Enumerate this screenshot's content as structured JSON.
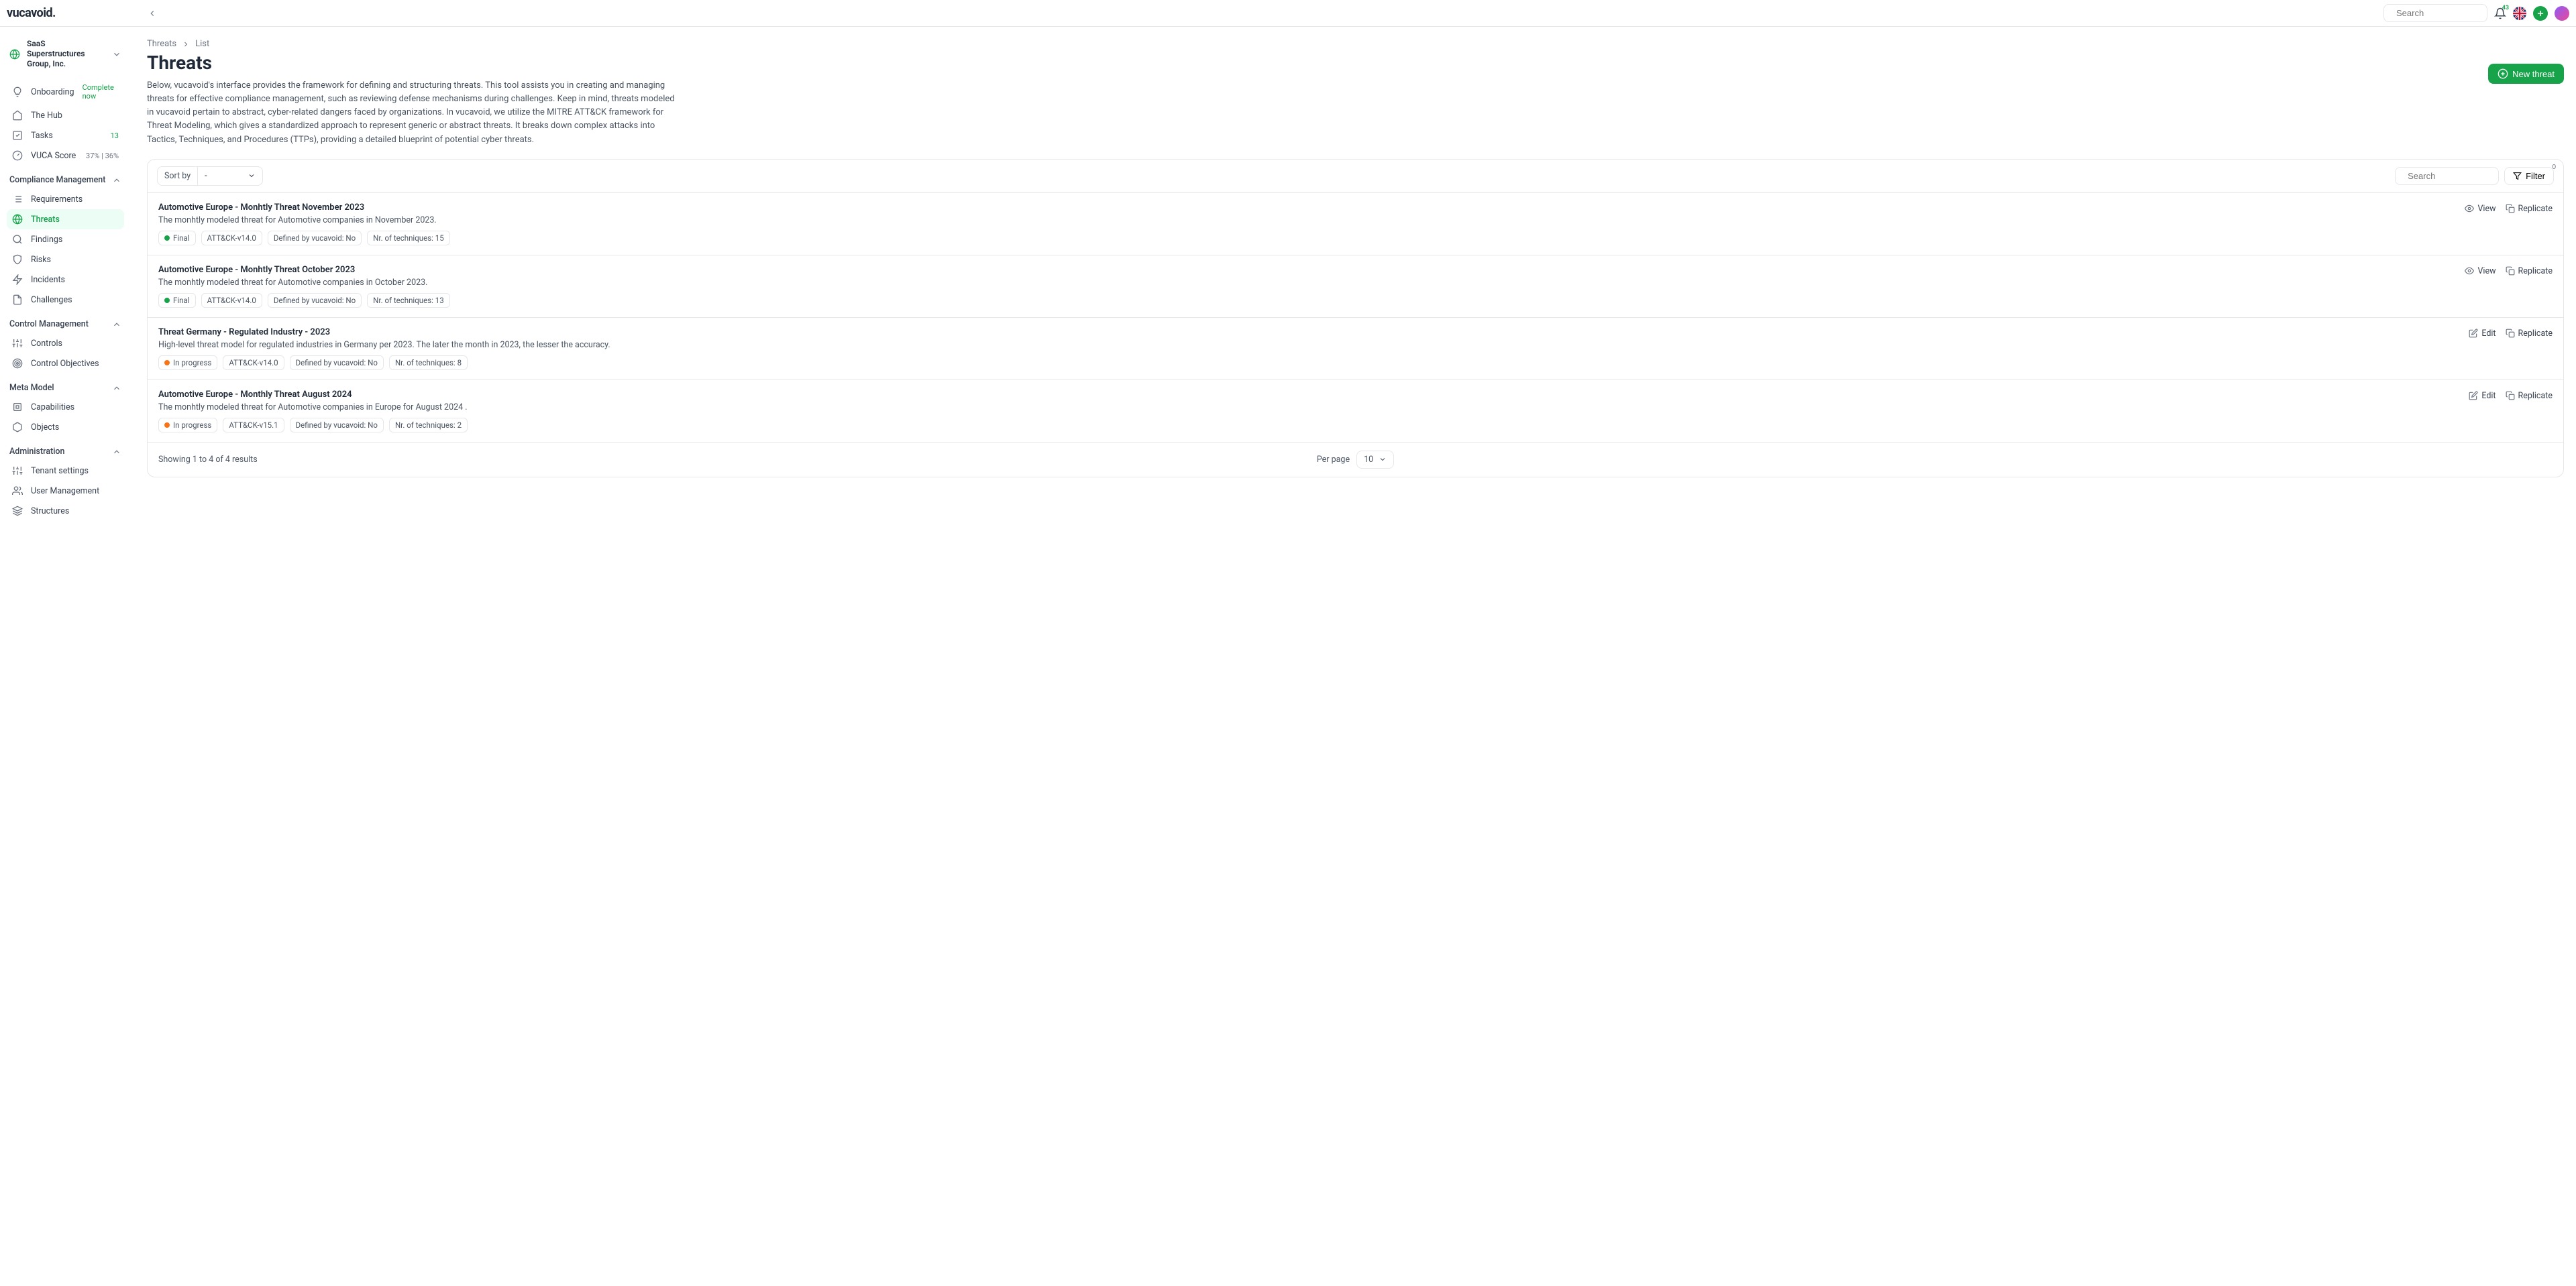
{
  "header": {
    "logo": "vucavoid.",
    "search_placeholder": "Search",
    "notif_count": "43"
  },
  "org": {
    "name": "SaaS Superstructures Group, Inc."
  },
  "sidebar": {
    "top": [
      {
        "label": "Onboarding",
        "badge": "Complete now",
        "badge_kind": "green"
      },
      {
        "label": "The Hub"
      },
      {
        "label": "Tasks",
        "badge": "13",
        "badge_kind": "green"
      },
      {
        "label": "VUCA Score",
        "badge": "37% | 36%",
        "badge_kind": "grey"
      }
    ],
    "sections": [
      {
        "title": "Compliance Management",
        "items": [
          {
            "label": "Requirements"
          },
          {
            "label": "Threats",
            "active": true
          },
          {
            "label": "Findings"
          },
          {
            "label": "Risks"
          },
          {
            "label": "Incidents"
          },
          {
            "label": "Challenges"
          }
        ]
      },
      {
        "title": "Control Management",
        "items": [
          {
            "label": "Controls"
          },
          {
            "label": "Control Objectives"
          }
        ]
      },
      {
        "title": "Meta Model",
        "items": [
          {
            "label": "Capabilities"
          },
          {
            "label": "Objects"
          }
        ]
      },
      {
        "title": "Administration",
        "items": [
          {
            "label": "Tenant settings"
          },
          {
            "label": "User Management"
          },
          {
            "label": "Structures"
          }
        ]
      }
    ]
  },
  "breadcrumb": {
    "a": "Threats",
    "b": "List"
  },
  "page": {
    "title": "Threats",
    "description": "Below, vucavoid's interface provides the framework for defining and structuring threats. This tool assists you in creating and managing threats for effective compliance management, such as reviewing defense mechanisms during challenges. Keep in mind, threats modeled in vucavoid pertain to abstract, cyber-related dangers faced by organizations. In vucavoid, we utilize the MITRE ATT&CK framework for Threat Modeling, which gives a standardized approach to represent generic or abstract threats. It breaks down complex attacks into Tactics, Techniques, and Procedures (TTPs), providing a detailed blueprint of potential cyber threats.",
    "new_button": "New threat"
  },
  "toolbar": {
    "sort_label": "Sort by",
    "sort_value": "-",
    "search_placeholder": "Search",
    "filter_label": "Filter",
    "filter_count": "0"
  },
  "threats": [
    {
      "title": "Automotive Europe - Monhtly Threat November 2023",
      "desc": "The monhtly modeled threat for Automotive companies in November 2023.",
      "status": "Final",
      "status_color": "green",
      "version": "ATT&CK-v14.0",
      "defined": "Defined by vucavoid: No",
      "techniques": "Nr. of techniques: 15",
      "action_primary": "View"
    },
    {
      "title": "Automotive Europe - Monhtly Threat October 2023",
      "desc": "The monhtly modeled threat for Automotive companies in October 2023.",
      "status": "Final",
      "status_color": "green",
      "version": "ATT&CK-v14.0",
      "defined": "Defined by vucavoid: No",
      "techniques": "Nr. of techniques: 13",
      "action_primary": "View"
    },
    {
      "title": "Threat Germany - Regulated Industry - 2023",
      "desc": "High-level threat model for regulated industries in Germany per 2023. The later the month in 2023, the lesser the accuracy.",
      "status": "In progress",
      "status_color": "orange",
      "version": "ATT&CK-v14.0",
      "defined": "Defined by vucavoid: No",
      "techniques": "Nr. of techniques: 8",
      "action_primary": "Edit"
    },
    {
      "title": "Automotive Europe - Monthly Threat August 2024",
      "desc": "The monhtly modeled threat for Automotive companies in Europe for August 2024 .",
      "status": "In progress",
      "status_color": "orange",
      "version": "ATT&CK-v15.1",
      "defined": "Defined by vucavoid: No",
      "techniques": "Nr. of techniques: 2",
      "action_primary": "Edit"
    }
  ],
  "replicate_label": "Replicate",
  "footer": {
    "showing": "Showing 1 to 4 of 4 results",
    "per_page_label": "Per page",
    "per_page_value": "10"
  }
}
